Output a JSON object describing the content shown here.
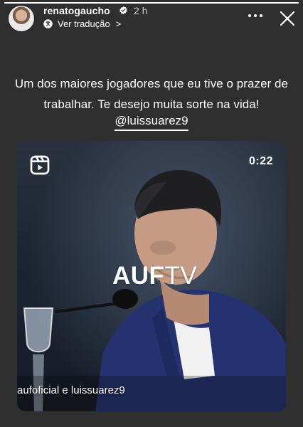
{
  "story": {
    "progress": 1.0
  },
  "header": {
    "username": "renatogaucho",
    "verified": true,
    "time": "2 h",
    "translate_label": "Ver tradução",
    "translate_chevron": ">",
    "more_icon": "more-icon",
    "close_icon": "close-icon"
  },
  "caption": {
    "text": "Um dos maiores jogadores que eu tive o prazer de trabalhar. Te desejo muita sorte na vida!",
    "mention": "@luissuarez9"
  },
  "video_card": {
    "duration": "0:22",
    "logo_primary": "AUF",
    "logo_secondary": "TV",
    "credit": "aufoficial e luissuarez9"
  },
  "colors": {
    "background": "#2f2f2f",
    "text": "#ffffff",
    "card_bg": "#324158"
  }
}
